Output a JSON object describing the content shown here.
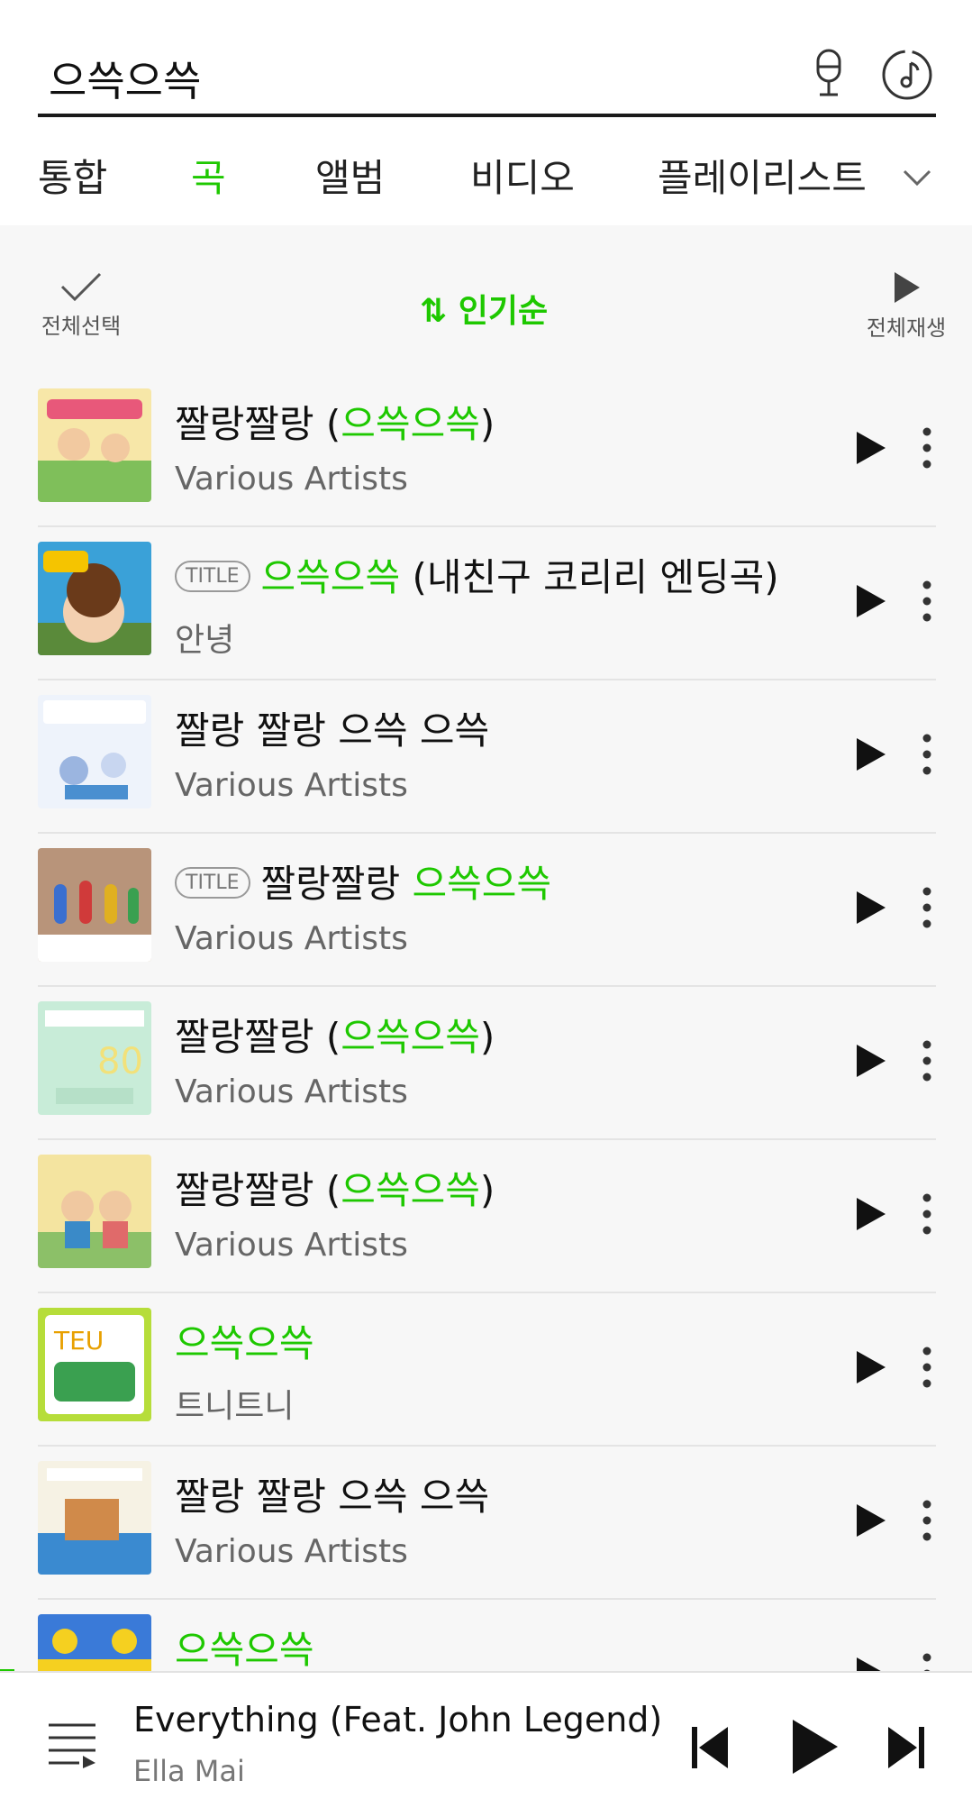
{
  "search": {
    "query": "으쓱으쓱"
  },
  "tabs": [
    {
      "label": "통합",
      "active": false
    },
    {
      "label": "곡",
      "active": true
    },
    {
      "label": "앨범",
      "active": false
    },
    {
      "label": "비디오",
      "active": false
    },
    {
      "label": "플레이리스트",
      "active": false
    }
  ],
  "toolbar": {
    "select_all": "전체선택",
    "sort": "인기순",
    "play_all": "전체재생"
  },
  "songs": [
    {
      "badge": "",
      "pre": "짤랑짤랑 (",
      "hl": "으쓱으쓱",
      "post": ")",
      "artist": "Various Artists"
    },
    {
      "badge": "TITLE",
      "pre": "",
      "hl": "으쓱으쓱",
      "post": " (내친구 코리리 엔딩곡)",
      "artist": "안녕"
    },
    {
      "badge": "",
      "pre": "짤랑 짤랑 으쓱 으쓱",
      "hl": "",
      "post": "",
      "artist": "Various Artists"
    },
    {
      "badge": "TITLE",
      "pre": "짤랑짤랑 ",
      "hl": "으쓱으쓱",
      "post": "",
      "artist": "Various Artists"
    },
    {
      "badge": "",
      "pre": "짤랑짤랑 (",
      "hl": "으쓱으쓱",
      "post": ")",
      "artist": "Various Artists"
    },
    {
      "badge": "",
      "pre": "짤랑짤랑 (",
      "hl": "으쓱으쓱",
      "post": ")",
      "artist": "Various Artists"
    },
    {
      "badge": "",
      "pre": "",
      "hl": "으쓱으쓱",
      "post": "",
      "artist": "트니트니"
    },
    {
      "badge": "",
      "pre": "짤랑 짤랑 으쓱 으쓱",
      "hl": "",
      "post": "",
      "artist": "Various Artists"
    },
    {
      "badge": "",
      "pre": "",
      "hl": "으쓱으쓱",
      "post": "",
      "artist": ""
    }
  ],
  "player": {
    "title": "Everything (Feat. John Legend)",
    "artist": "Ella Mai"
  },
  "colors": {
    "accent": "#1ec800",
    "text": "#111111",
    "muted": "#666666"
  },
  "icons": [
    "mic-icon",
    "music-note-icon",
    "chevron-down-icon",
    "check-icon",
    "sort-icon",
    "play-icon",
    "more-icon",
    "queue-icon",
    "previous-icon",
    "next-icon"
  ]
}
